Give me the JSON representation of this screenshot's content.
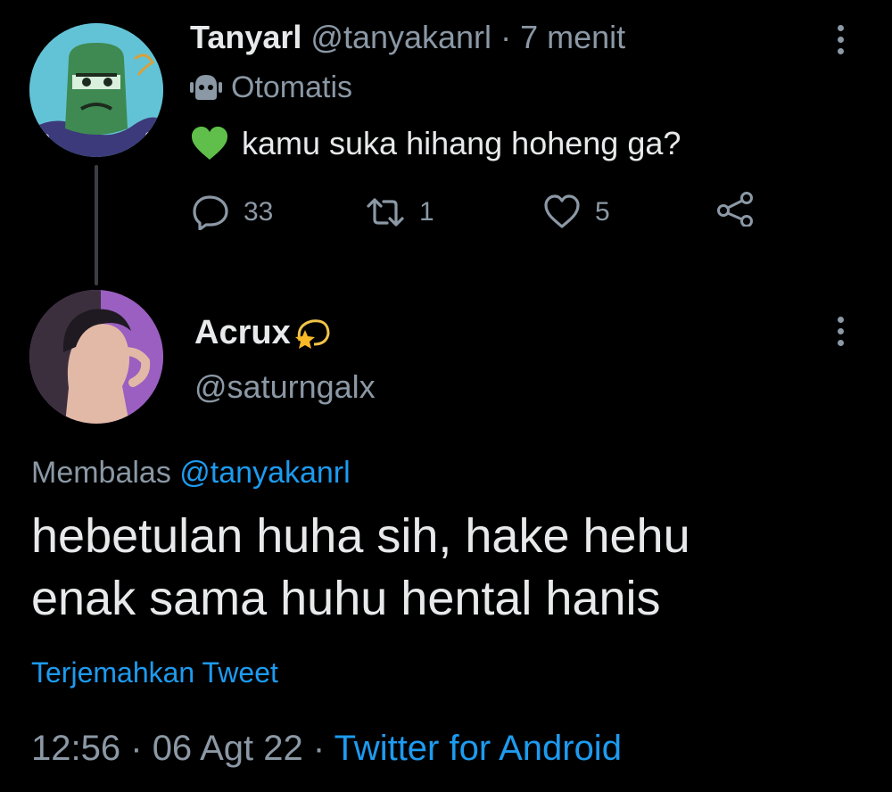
{
  "original_tweet": {
    "display_name": "Tanyarl",
    "handle": "@tanyakanrl",
    "separator": "·",
    "time_ago": "7 menit",
    "automated_label": "Otomatis",
    "text": "kamu suka hihang hoheng ga?",
    "avatar_icon": "cartoon-avatar",
    "actions": {
      "reply_count": "33",
      "retweet_count": "1",
      "like_count": "5"
    }
  },
  "reply_tweet": {
    "display_name": "Acrux",
    "name_emoji_icon": "dizzy-star-icon",
    "handle": "@saturngalx",
    "replying_prefix": "Membalas",
    "replying_to": "@tanyakanrl",
    "text_lines": [
      "hebetulan huha sih, hake hehu",
      "enak sama huhu hental hanis"
    ],
    "translate_label": "Terjemahkan Tweet",
    "time": "12:56",
    "date": "06 Agt 22",
    "separator": "·",
    "source": "Twitter for Android"
  },
  "colors": {
    "background": "#000000",
    "primary_text": "#e7e9ea",
    "secondary_text": "#8b98a5",
    "accent": "#1d9bf0",
    "heart_emoji": "#5fbf4a"
  }
}
